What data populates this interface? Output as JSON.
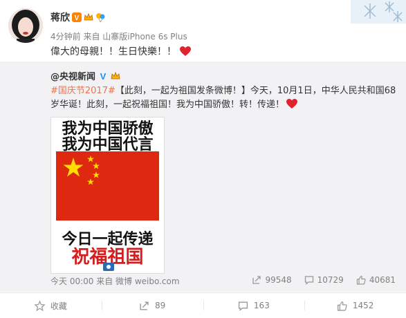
{
  "post": {
    "author": "蒋欣",
    "meta": "4分钟前 来自 山寨版iPhone 6s Plus",
    "text": "偉大的母親！！生日快樂！！"
  },
  "repost": {
    "author": "@央视新闻",
    "tag": "#国庆节2017#",
    "text": "【此刻，一起为祖国发条微博！】今天，10月1日，中华人民共和国68岁华诞！此刻，一起祝福祖国！我为中国骄傲！转！传递！",
    "poster": {
      "line1": "我为中国骄傲",
      "line2": "我为中国代言",
      "line3": "今日一起传递",
      "line4": "祝福祖国"
    },
    "footer": "今天 00:00 来自 微博 weibo.com",
    "stats": {
      "share": "99548",
      "comment": "10729",
      "like": "40681"
    }
  },
  "actions": {
    "favorite": "收藏",
    "share": "89",
    "comment": "163",
    "like": "1452"
  },
  "colors": {
    "accent": "#eb7350",
    "flag_red": "#de2910",
    "flag_yellow": "#ffde00",
    "heart": "#e0242f"
  }
}
